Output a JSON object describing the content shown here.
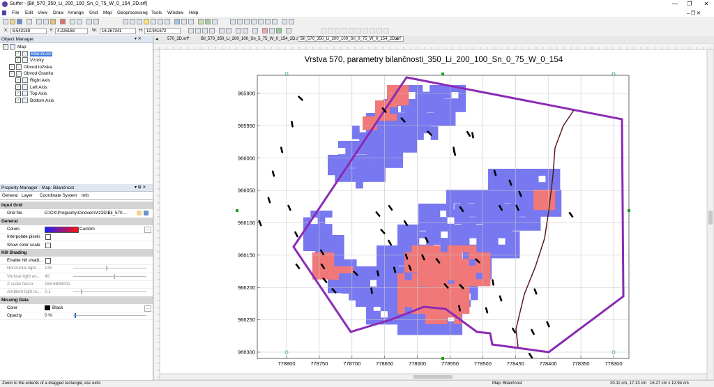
{
  "window": {
    "title": "Surfer - [Bil_570_350_Li_200_100_Sn_0_75_W_0_154_2D.srf]",
    "controls": [
      "—",
      "❐",
      "✕"
    ]
  },
  "menu": [
    "File",
    "Edit",
    "View",
    "Draw",
    "Arrange",
    "Grid",
    "Map",
    "Geoprocessing",
    "Tools",
    "Window",
    "Help"
  ],
  "coords": {
    "x_label": "X:",
    "x": "6.543159",
    "y_label": "Y:",
    "y": "4.226168",
    "w_label": "W:",
    "w": "16.267341",
    "h_label": "H:",
    "h": "12.941672"
  },
  "tabs": [
    {
      "label": "570_2D.srf*",
      "active": false
    },
    {
      "label": "Bil_570_350_Li_200_100_Sn_5_75_W_0_154_2D.srf*",
      "active": false
    },
    {
      "label": "Bil_570_350_Li_200_100_Sn_0_75_W_0_154_2D.srf",
      "active": true
    }
  ],
  "object_manager": {
    "title": "Object Manager",
    "items": [
      {
        "label": "Map",
        "indent": 0,
        "checked": true,
        "selected": false
      },
      {
        "label": "Bilančnost",
        "indent": 2,
        "checked": true,
        "selected": true
      },
      {
        "label": "Vzorky",
        "indent": 2,
        "checked": true,
        "selected": false
      },
      {
        "label": "Obvod ložiska",
        "indent": 1,
        "checked": true,
        "selected": false
      },
      {
        "label": "Obvod Granitu",
        "indent": 1,
        "checked": true,
        "selected": false
      },
      {
        "label": "Right Axis",
        "indent": 2,
        "checked": true,
        "selected": false
      },
      {
        "label": "Left Axis",
        "indent": 2,
        "checked": true,
        "selected": false
      },
      {
        "label": "Top Axis",
        "indent": 2,
        "checked": true,
        "selected": false
      },
      {
        "label": "Bottom Axis",
        "indent": 2,
        "checked": true,
        "selected": false
      }
    ]
  },
  "property_manager": {
    "title": "Property Manager - Map: Bilančnost",
    "tabs": [
      "General",
      "Layer",
      "Coordinate System",
      "Info"
    ],
    "rows": [
      {
        "type": "section",
        "label": "Input Grid"
      },
      {
        "type": "prop",
        "label": "Grid file",
        "value": "D:\\CK\\Programy\\Cinovec\\Viz2D\\Bil_570..."
      },
      {
        "type": "section",
        "label": "General"
      },
      {
        "type": "prop",
        "label": "Colors",
        "value": "Custom",
        "colorbar": true
      },
      {
        "type": "prop",
        "label": "Interpolate pixels",
        "value": "",
        "checkbox": true
      },
      {
        "type": "prop",
        "label": "Show color scale",
        "value": "",
        "checkbox": true
      },
      {
        "type": "section",
        "label": "Hill Shading"
      },
      {
        "type": "prop",
        "label": "Enable hill shadi...",
        "value": "",
        "checkbox": true
      },
      {
        "type": "prop",
        "label": "Horizontal light ...",
        "value": "135",
        "disabled": true,
        "slider": 0.45
      },
      {
        "type": "prop",
        "label": "Vertical light an...",
        "value": "45",
        "disabled": true,
        "slider": 0.55
      },
      {
        "type": "prop",
        "label": "Z scale factor",
        "value": "168.6898041",
        "disabled": true
      },
      {
        "type": "prop",
        "label": "Ambient light in...",
        "value": "0.1",
        "disabled": true,
        "slider": 0.1
      },
      {
        "type": "section",
        "label": "Missing Data"
      },
      {
        "type": "prop",
        "label": "Color",
        "value": "Black",
        "swatch": "#000000"
      },
      {
        "type": "prop",
        "label": "Opacity",
        "value": "0 %",
        "slider": 0.02
      }
    ]
  },
  "map": {
    "title": "Vrstva 570, parametry bilančnosti_350_Li_200_100_Sn_0_75_W_0_154",
    "x_ticks": [
      "778800",
      "778750",
      "778700",
      "778650",
      "778600",
      "778550",
      "778500",
      "778450",
      "778400",
      "778350",
      "778300"
    ],
    "y_ticks": [
      "965900",
      "965950",
      "966000",
      "966050",
      "966100",
      "966150",
      "966200",
      "966250",
      "966300"
    ],
    "colors": {
      "blue": "#7878f0",
      "red": "#f07878",
      "polygon": "#8a2bb5",
      "granite": "#5a1a1a",
      "samples": "#000000"
    }
  },
  "status": {
    "left": "Zoom to the extents of a dragged rectangle; esc exits",
    "map": "Map: Bilančnost",
    "pos": "20.11 cm, 17.13 cm",
    "size": "16.27 cm x 12.94 cm"
  }
}
